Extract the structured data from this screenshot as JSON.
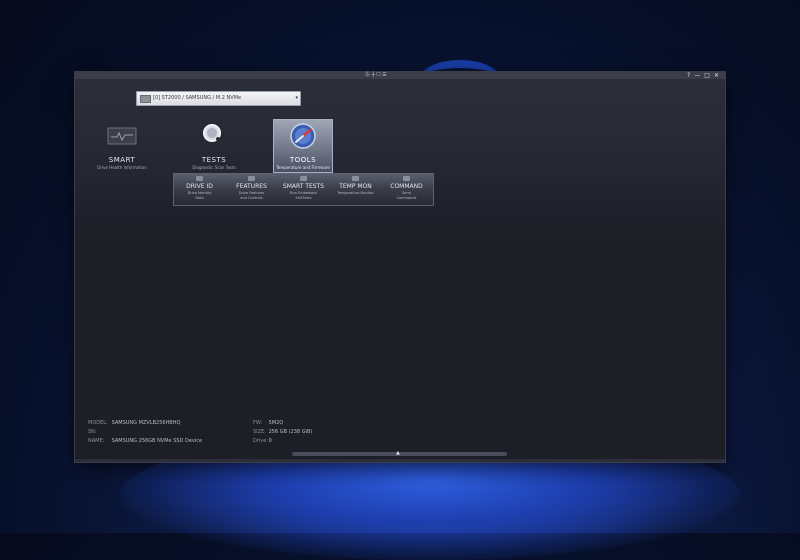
{
  "titlebar": {
    "center_text": "Ⓢ ┼ ☐ ☰",
    "controls": [
      "?",
      "—",
      "□",
      "✕"
    ]
  },
  "drive_select": {
    "value": "[0] ST2000 / SAMSUNG / M.2 NVMe"
  },
  "nav": [
    {
      "label": "SMART",
      "sub": "Drive Health Information",
      "icon": "monitor-icon",
      "active": false
    },
    {
      "label": "TESTS",
      "sub": "Diagnostic Scan Tests",
      "icon": "magnifier-icon",
      "active": false
    },
    {
      "label": "TOOLS",
      "sub": "Temperature and Firmware",
      "icon": "gauge-icon",
      "active": true
    }
  ],
  "submenu": [
    {
      "label": "DRIVE ID",
      "desc": "Drive Identity\nData"
    },
    {
      "label": "FEATURES",
      "desc": "Drive Features\nand Controls"
    },
    {
      "label": "SMART TESTS",
      "desc": "Run Embedded\nSelf-Tests"
    },
    {
      "label": "TEMP MON",
      "desc": "Temperature Monitor"
    },
    {
      "label": "COMMAND",
      "desc": "Send\nCommands"
    }
  ],
  "info_left": [
    {
      "key": "MODEL:",
      "value": "SAMSUNG MZVLB256HBHQ"
    },
    {
      "key": "SN:",
      "value": ""
    },
    {
      "key": "NAME:",
      "value": "SAMSUNG 256GB NVMe SSD Device"
    }
  ],
  "info_right": [
    {
      "key": "FW:",
      "value": "5M2Q"
    },
    {
      "key": "SIZE:",
      "value": "256 GB (238 GiB)"
    },
    {
      "key": "Drive:",
      "value": "0"
    }
  ],
  "colors": {
    "window_bg": "#1d1e26",
    "active_tab": "#6d7486",
    "select_bg": "#f4f4f6",
    "wallpaper_accent": "#1f4fd8"
  }
}
